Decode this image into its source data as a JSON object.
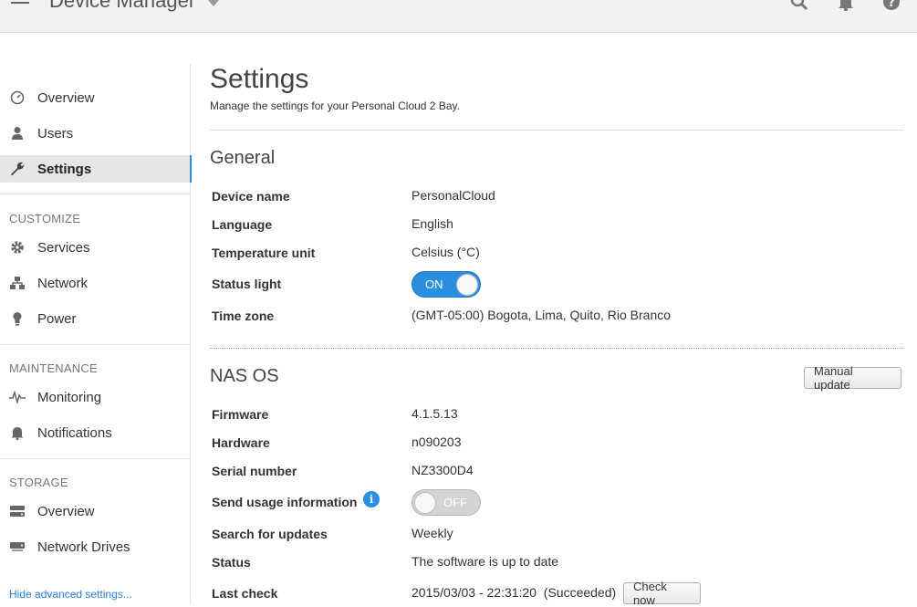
{
  "header": {
    "app_title": "Device Manager"
  },
  "icons": {
    "menu": "hamburger-menu-icon",
    "search": "search-icon",
    "bell": "bell-icon",
    "help": "help-icon",
    "info": "i"
  },
  "colors": {
    "accent": "#2a8fe0",
    "link": "#2a7fd4"
  },
  "sidebar": {
    "items": [
      {
        "label": "Overview",
        "icon": "dashboard-icon"
      },
      {
        "label": "Users",
        "icon": "user-icon"
      },
      {
        "label": "Settings",
        "icon": "wrench-icon",
        "active": true
      }
    ],
    "customize_header": "CUSTOMIZE",
    "customize": [
      {
        "label": "Services",
        "icon": "gear-icon"
      },
      {
        "label": "Network",
        "icon": "network-icon"
      },
      {
        "label": "Power",
        "icon": "bulb-icon"
      }
    ],
    "maintenance_header": "MAINTENANCE",
    "maintenance": [
      {
        "label": "Monitoring",
        "icon": "pulse-icon"
      },
      {
        "label": "Notifications",
        "icon": "bell-icon"
      }
    ],
    "storage_header": "STORAGE",
    "storage": [
      {
        "label": "Overview",
        "icon": "drive-icon"
      },
      {
        "label": "Network Drives",
        "icon": "network-drive-icon"
      }
    ],
    "hide_link": "Hide advanced settings..."
  },
  "main": {
    "title": "Settings",
    "subtitle": "Manage the settings for your Personal Cloud 2 Bay.",
    "general": {
      "title": "General",
      "device_name_label": "Device name",
      "device_name_value": "PersonalCloud",
      "language_label": "Language",
      "language_value": "English",
      "temp_label": "Temperature unit",
      "temp_value": "Celsius (°C)",
      "status_light_label": "Status light",
      "status_light_value": "ON",
      "timezone_label": "Time zone",
      "timezone_value": "(GMT-05:00) Bogota, Lima, Quito, Rio Branco"
    },
    "nasos": {
      "title": "NAS OS",
      "manual_update_label": "Manual update",
      "firmware_label": "Firmware",
      "firmware_value": "4.1.5.13",
      "hardware_label": "Hardware",
      "hardware_value": "n090203",
      "serial_label": "Serial number",
      "serial_value": "NZ3300D4",
      "usage_label": "Send usage information",
      "usage_value": "OFF",
      "search_label": "Search for updates",
      "search_value": "Weekly",
      "status_label": "Status",
      "status_value": "The software is up to date",
      "last_check_label": "Last check",
      "last_check_value": "2015/03/03 - 22:31:20  (Succeeded)",
      "check_now_label": "Check now"
    }
  }
}
